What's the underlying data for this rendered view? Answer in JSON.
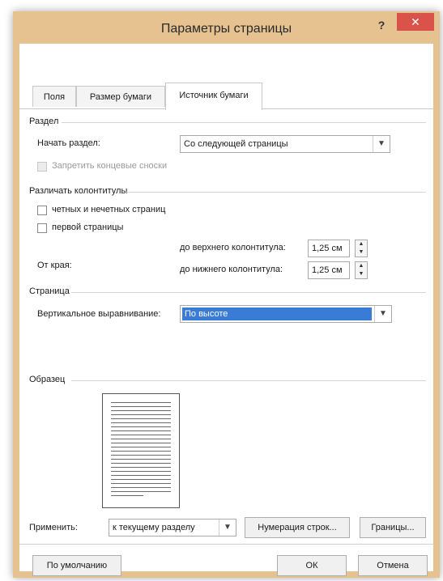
{
  "window": {
    "title": "Параметры страницы",
    "help_label": "?",
    "close_label": "✕"
  },
  "tabs": [
    {
      "label": "Поля",
      "active": false
    },
    {
      "label": "Размер бумаги",
      "active": false
    },
    {
      "label": "Источник бумаги",
      "active": true
    }
  ],
  "section": {
    "group_label": "Раздел",
    "start_label": "Начать раздел:",
    "start_value": "Со следующей страницы",
    "suppress_endnotes_label": "Запретить концевые сноски"
  },
  "headers_footers": {
    "group_label": "Различать колонтитулы",
    "odd_even_label": "четных и нечетных страниц",
    "first_page_label": "первой страницы",
    "from_edge_label": "От края:",
    "header_label": "до верхнего колонтитула:",
    "header_value": "1,25 см",
    "footer_label": "до нижнего колонтитула:",
    "footer_value": "1,25 см"
  },
  "page": {
    "group_label": "Страница",
    "valign_label": "Вертикальное выравнивание:",
    "valign_value": "По высоте"
  },
  "preview": {
    "group_label": "Образец",
    "apply_label": "Применить:",
    "apply_value": "к текущему разделу",
    "line_numbers_label": "Нумерация строк...",
    "borders_label": "Границы..."
  },
  "footer": {
    "default_label": "По умолчанию",
    "ok_label": "ОК",
    "cancel_label": "Отмена"
  },
  "icons": {
    "dropdown": "chevron-down-icon",
    "spin_up": "triangle-up-icon",
    "spin_down": "triangle-down-icon"
  },
  "colors": {
    "title_bar": "#e6c290",
    "close_button": "#d9534a",
    "selection": "#3a7bd5"
  }
}
